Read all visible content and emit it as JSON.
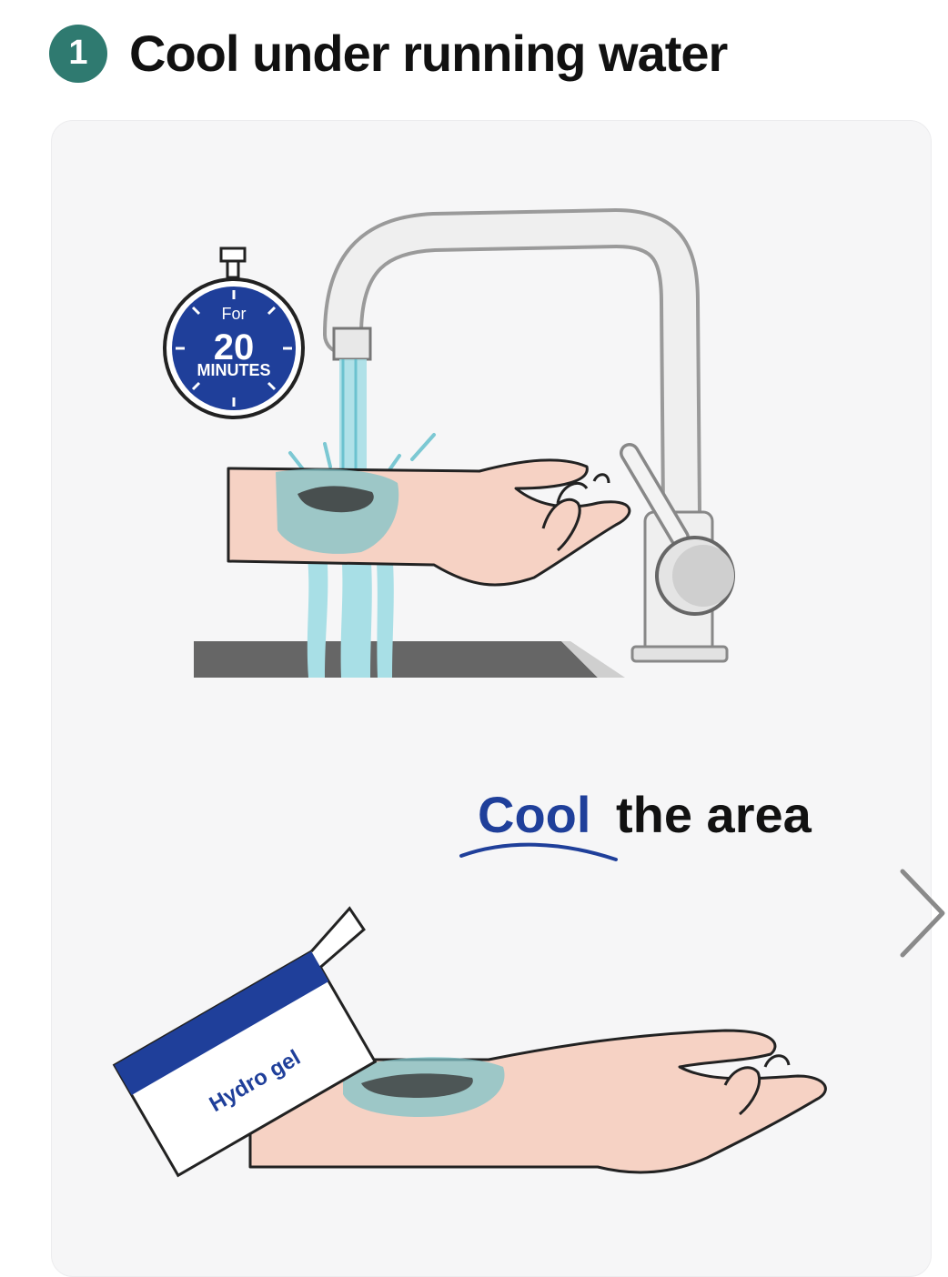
{
  "header": {
    "step_number": "1",
    "title": "Cool under running water"
  },
  "illustration1": {
    "timer_for": "For",
    "timer_number": "20",
    "timer_unit": "MINUTES",
    "alt_icon": "faucet-icon"
  },
  "illustration2": {
    "caption_highlight": "Cool",
    "caption_rest": "the area",
    "packet_label": "Hydro gel",
    "alt_icon": "hydrogel-packet-icon"
  },
  "carousel": {
    "next_icon": "chevron-right-icon"
  },
  "colors": {
    "badge": "#2f7a70",
    "timer_blue": "#1f3f9a",
    "caption_blue": "#1f3f9a",
    "water": "#8fd3dc",
    "skin": "#f6d2c4",
    "sink": "#666666"
  }
}
